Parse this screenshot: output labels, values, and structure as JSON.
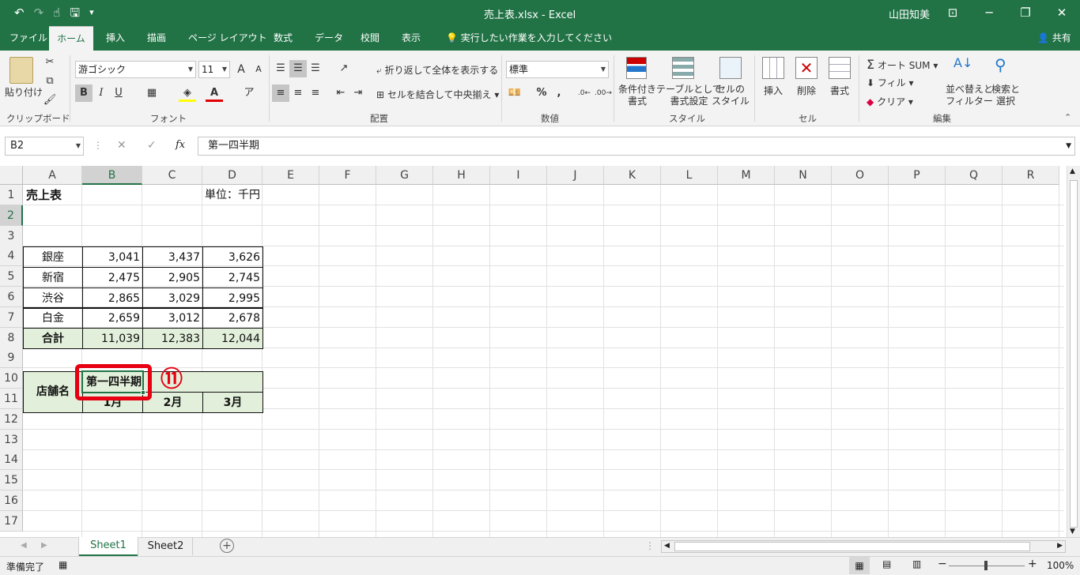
{
  "title_bar": {
    "doc_title": "売上表.xlsx - Excel",
    "user": "山田知美",
    "undo": "↶",
    "redo": "↷",
    "touch": "☝",
    "save": "🖫",
    "qat_more": "▾",
    "ribbon_display": "⊡",
    "minimize": "─",
    "restore": "❐",
    "close": "✕"
  },
  "tabs": [
    "ファイル",
    "ホーム",
    "挿入",
    "描画",
    "ページ レイアウト",
    "数式",
    "データ",
    "校閲",
    "表示"
  ],
  "tell_me": "実行したい作業を入力してください",
  "share": "共有",
  "ribbon": {
    "clipboard": {
      "paste": "貼り付け",
      "label": "クリップボード"
    },
    "font": {
      "name": "游ゴシック",
      "size": "11",
      "grow": "A",
      "shrink": "A",
      "bold": "B",
      "italic": "I",
      "underline": "U",
      "color_a": "A",
      "label": "フォント"
    },
    "alignment": {
      "wrap": "折り返して全体を表示する",
      "merge": "セルを結合して中央揃え",
      "label": "配置"
    },
    "number": {
      "format": "標準",
      "percent": "%",
      "comma": ",",
      "label": "数値"
    },
    "styles": {
      "conditional": [
        "条件付き",
        "書式"
      ],
      "table": [
        "テーブルとして",
        "書式設定"
      ],
      "cell": [
        "セルの",
        "スタイル"
      ],
      "label": "スタイル"
    },
    "cells": {
      "insert": "挿入",
      "delete": "削除",
      "format": "書式",
      "label": "セル"
    },
    "editing": {
      "autosum": "オート SUM",
      "fill": "フィル",
      "clear": "クリア",
      "sort": [
        "並べ替えと",
        "フィルター"
      ],
      "find": [
        "検索と",
        "選択"
      ],
      "label": "編集"
    }
  },
  "formula_bar": {
    "name_box": "B2",
    "cancel": "✕",
    "enter": "✓",
    "fx": "fx",
    "content": "第一四半期"
  },
  "columns": [
    "A",
    "B",
    "C",
    "D",
    "E",
    "F",
    "G",
    "H",
    "I",
    "J",
    "K",
    "L",
    "M",
    "N",
    "O",
    "P",
    "Q",
    "R"
  ],
  "rows": [
    "1",
    "2",
    "3",
    "4",
    "5",
    "6",
    "7",
    "8",
    "9",
    "10",
    "11",
    "12",
    "13",
    "14",
    "15",
    "16",
    "17"
  ],
  "sheet": {
    "title": "売上表",
    "unit": "単位：千円",
    "store_header": "店舗名",
    "quarter_header": "第一四半期",
    "months": [
      "1月",
      "2月",
      "3月"
    ],
    "stores": [
      {
        "name": "銀座",
        "values": [
          "3,041",
          "3,437",
          "3,626"
        ]
      },
      {
        "name": "新宿",
        "values": [
          "2,475",
          "2,905",
          "2,745"
        ]
      },
      {
        "name": "渋谷",
        "values": [
          "2,865",
          "3,029",
          "2,995"
        ]
      },
      {
        "name": "白金",
        "values": [
          "2,659",
          "3,012",
          "2,678"
        ]
      }
    ],
    "total_label": "合計",
    "totals": [
      "11,039",
      "12,383",
      "12,044"
    ]
  },
  "annotation": {
    "step": "⑪",
    "highlight_color": "#e60012"
  },
  "sheet_tabs": [
    "Sheet1",
    "Sheet2"
  ],
  "status": {
    "ready": "準備完了",
    "zoom": "100%"
  },
  "colors": {
    "excel_green": "#217346",
    "table_fill": "#e2efda"
  }
}
